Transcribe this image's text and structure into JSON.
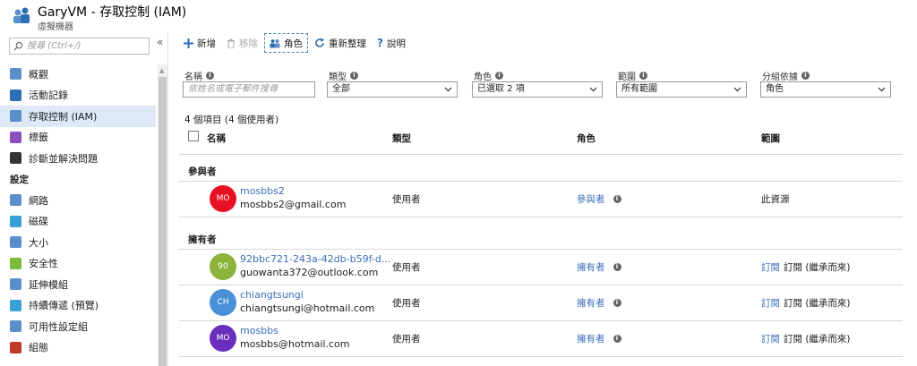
{
  "header": {
    "title": "GaryVM - 存取控制 (IAM)",
    "subtitle": "虛擬機器"
  },
  "sidebar": {
    "search_placeholder": "搜尋 (Ctrl+/)",
    "collapse": "«",
    "items": [
      {
        "label": "概觀",
        "icon": "overview-icon",
        "color": "#5b8fc9"
      },
      {
        "label": "活動記錄",
        "icon": "activity-log-icon",
        "color": "#2f6db4"
      },
      {
        "label": "存取控制 (IAM)",
        "icon": "users-icon",
        "color": "#5b8fc9",
        "active": true
      },
      {
        "label": "標籤",
        "icon": "tag-icon",
        "color": "#8a4fbf"
      },
      {
        "label": "診斷並解決問題",
        "icon": "tools-icon",
        "color": "#333333"
      }
    ],
    "section_label": "設定",
    "settings_items": [
      {
        "label": "網路",
        "icon": "network-icon",
        "color": "#5b8fc9"
      },
      {
        "label": "磁碟",
        "icon": "disk-icon",
        "color": "#3aa0d8"
      },
      {
        "label": "大小",
        "icon": "monitor-icon",
        "color": "#5b8fc9"
      },
      {
        "label": "安全性",
        "icon": "shield-icon",
        "color": "#7cba3b"
      },
      {
        "label": "延伸模組",
        "icon": "extensions-icon",
        "color": "#5b8fc9"
      },
      {
        "label": "持續傳遞 (預覽)",
        "icon": "delivery-icon",
        "color": "#3aa0d8"
      },
      {
        "label": "可用性設定組",
        "icon": "availability-icon",
        "color": "#5b8fc9"
      },
      {
        "label": "組態",
        "icon": "config-icon",
        "color": "#c0392b"
      }
    ]
  },
  "toolbar": {
    "add": "新增",
    "remove": "移除",
    "roles": "角色",
    "refresh": "重新整理",
    "help": "說明"
  },
  "filters": {
    "name_label": "名稱",
    "name_placeholder": "依姓名或電子郵件搜尋",
    "type_label": "類型",
    "type_value": "全部",
    "role_label": "角色",
    "role_value": "已選取 2 項",
    "scope_label": "範圍",
    "scope_value": "所有範圍",
    "group_label": "分組依據",
    "group_value": "角色"
  },
  "table": {
    "count": "4 個項目 (4 個使用者)",
    "headers": {
      "name": "名稱",
      "type": "類型",
      "role": "角色",
      "scope": "範圍"
    },
    "groups": [
      {
        "title": "參與者",
        "rows": [
          {
            "initials": "MO",
            "avatar_color": "#e81123",
            "name": "mosbbs2",
            "email": "mosbbs2@gmail.com",
            "type": "使用者",
            "role": "參與者",
            "scope_link": "",
            "scope": "此資源"
          }
        ]
      },
      {
        "title": "擁有者",
        "rows": [
          {
            "initials": "90",
            "avatar_color": "#8cb33a",
            "name": "92bbc721-243a-42db-b59f-d...",
            "email": "guowanta372@outlook.com",
            "type": "使用者",
            "role": "擁有者",
            "scope_link": "訂閱",
            "scope": "訂閱 (繼承而來)"
          },
          {
            "initials": "CH",
            "avatar_color": "#4a90d9",
            "name": "chiangtsungi",
            "email": "chiangtsungi@hotmail.com",
            "type": "使用者",
            "role": "擁有者",
            "scope_link": "訂閱",
            "scope": "訂閱 (繼承而來)"
          },
          {
            "initials": "MO",
            "avatar_color": "#6b2fbd",
            "name": "mosbbs",
            "email": "mosbbs@hotmail.com",
            "type": "使用者",
            "role": "擁有者",
            "scope_link": "訂閱",
            "scope": "訂閱 (繼承而來)"
          }
        ]
      }
    ]
  }
}
